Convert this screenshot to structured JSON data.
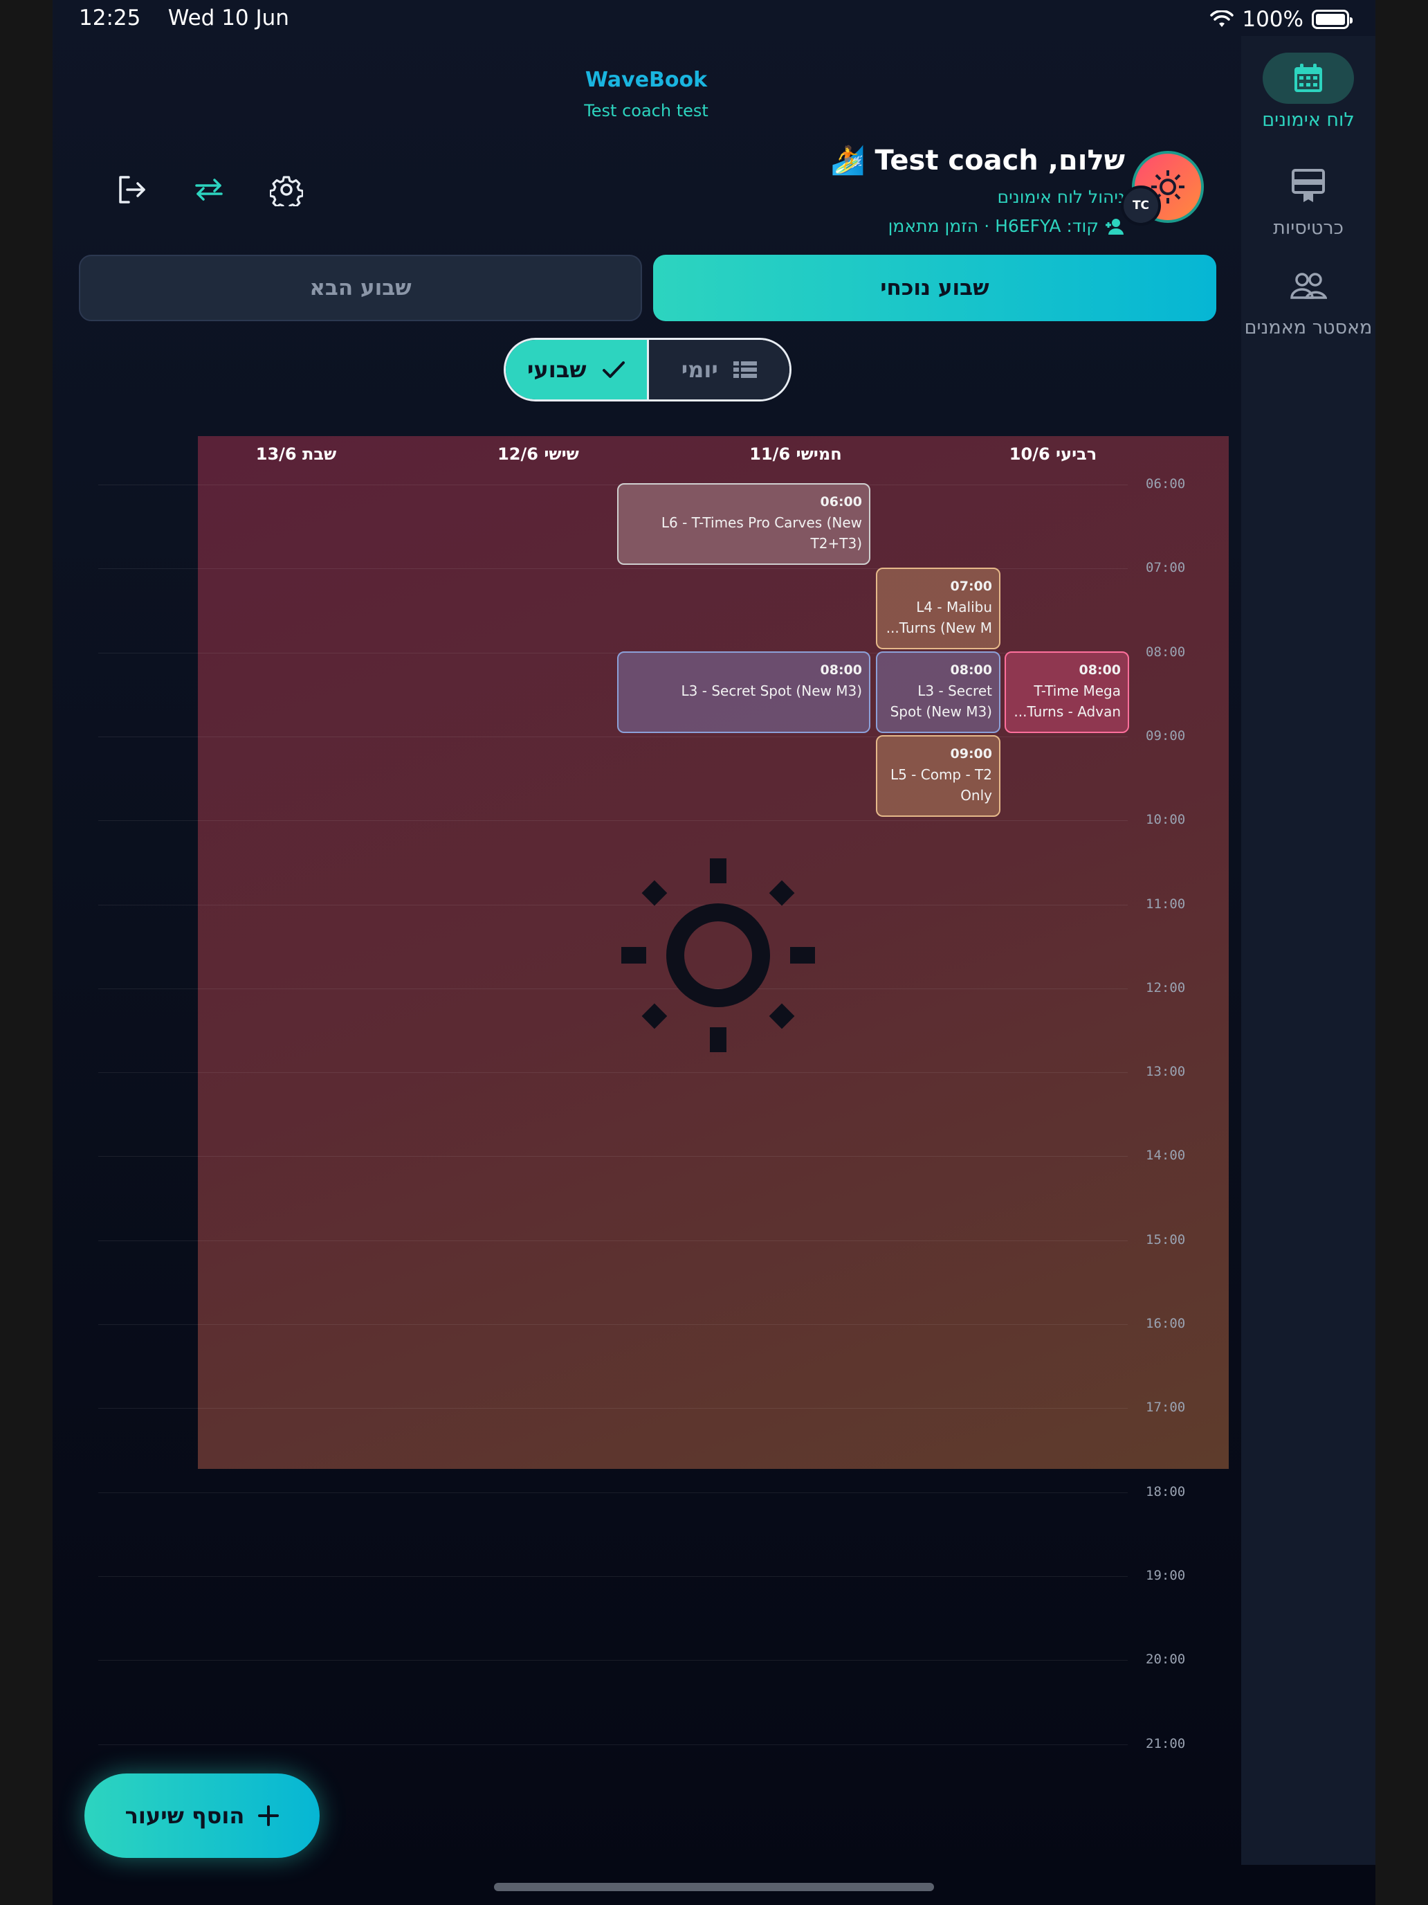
{
  "status_bar": {
    "time": "12:25",
    "date": "Wed 10 Jun",
    "battery": "100%",
    "battery_level": 1.0
  },
  "app": {
    "brand": "WaveBook",
    "subtitle": "Test coach test"
  },
  "user": {
    "greeting": "שלום, Test coach 🏄",
    "role_line": "ניהול לוח אימונים",
    "code_line": "קוד: H6EFYA · הזמן מתאמן",
    "avatar_initials": "TC"
  },
  "sidebar": {
    "items": [
      {
        "label": "לוח אימונים",
        "icon": "calendar-icon",
        "active": true
      },
      {
        "label": "כרטיסיות",
        "icon": "card-icon",
        "active": false
      },
      {
        "label": "מאסטר מאמנים",
        "icon": "people-icon",
        "active": false
      }
    ]
  },
  "header_icons": [
    "logout-icon",
    "swap-icon",
    "gear-icon"
  ],
  "week_tabs": {
    "current": "שבוע נוכחי",
    "next": "שבוע הבא"
  },
  "view_toggle": {
    "weekly": "שבועי",
    "daily": "יומי"
  },
  "calendar": {
    "days": [
      {
        "label": "רביעי 10/6"
      },
      {
        "label": "חמישי 11/6"
      },
      {
        "label": "שישי 12/6"
      },
      {
        "label": "שבת 13/6"
      }
    ],
    "hours": [
      "06:00",
      "07:00",
      "08:00",
      "09:00",
      "10:00",
      "11:00",
      "12:00",
      "13:00",
      "14:00",
      "15:00",
      "16:00",
      "17:00",
      "18:00",
      "19:00",
      "20:00",
      "21:00"
    ],
    "events": [
      {
        "time": "06:00",
        "title": "L6 - T-Times Pro Carves (New T2+T3)"
      },
      {
        "time": "07:00",
        "title": "L4 - Malibu Turns (New M..."
      },
      {
        "time": "08:00",
        "title": "L3 - Secret Spot (New M3)"
      },
      {
        "time": "08:00",
        "title": "L3 - Secret Spot (New M3)"
      },
      {
        "time": "08:00",
        "title": "T-Time Mega Turns - Advan..."
      },
      {
        "time": "09:00",
        "title": "L5 - Comp - T2 Only"
      }
    ]
  },
  "fab": {
    "label": "הוסף שיעור"
  },
  "colors": {
    "accent": "#2dd4bf",
    "brand": "#1ab5e0",
    "bg": "#0e1526"
  }
}
